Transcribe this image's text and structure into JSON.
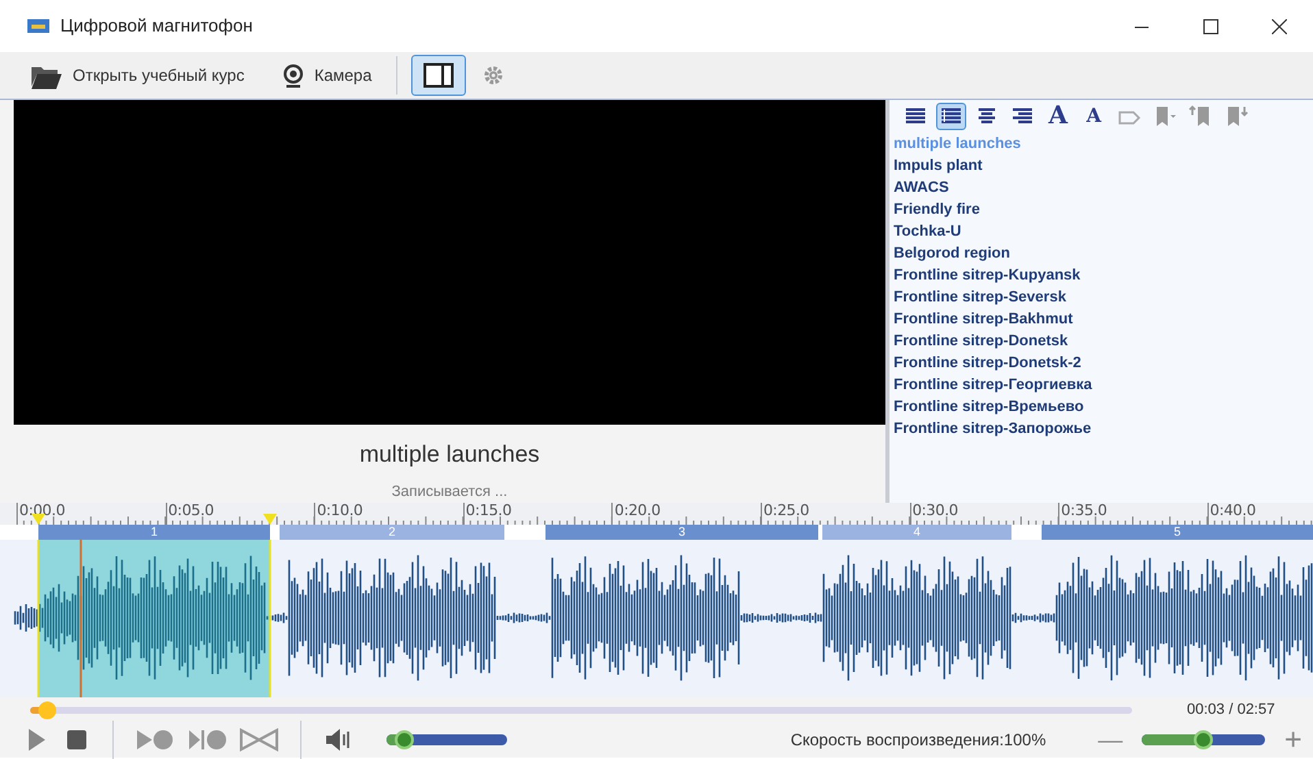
{
  "window": {
    "title": "Цифровой магнитофон"
  },
  "toolbar": [
    {
      "kind": "open",
      "label": "Открыть учебный курс"
    },
    {
      "kind": "camera",
      "label": "Камера"
    },
    {
      "kind": "layout",
      "selected": true
    },
    {
      "kind": "settings",
      "selected": false
    }
  ],
  "format_toolbar": [
    {
      "kind": "align-left",
      "selected": false
    },
    {
      "kind": "justify",
      "selected": true
    },
    {
      "kind": "align-center",
      "selected": false
    },
    {
      "kind": "align-right",
      "selected": false
    },
    {
      "kind": "font-grow",
      "label": "A"
    },
    {
      "kind": "font-shrink",
      "label": "A"
    },
    {
      "kind": "tag"
    },
    {
      "kind": "bookmark-menu"
    },
    {
      "kind": "bookmark-up"
    },
    {
      "kind": "bookmark-down"
    }
  ],
  "video": {
    "caption": "multiple launches",
    "status": "Записывается ..."
  },
  "phrases": [
    {
      "text": "multiple launches",
      "selected": true
    },
    {
      "text": "Impuls plant",
      "selected": false
    },
    {
      "text": "AWACS",
      "selected": false
    },
    {
      "text": "Friendly fire",
      "selected": false
    },
    {
      "text": "Tochka-U",
      "selected": false
    },
    {
      "text": "Belgorod region",
      "selected": false
    },
    {
      "text": "Frontline sitrep-Kupyansk",
      "selected": false
    },
    {
      "text": "Frontline sitrep-Seversk",
      "selected": false
    },
    {
      "text": "Frontline sitrep-Bakhmut",
      "selected": false
    },
    {
      "text": "Frontline sitrep-Donetsk",
      "selected": false
    },
    {
      "text": "Frontline sitrep-Donetsk-2",
      "selected": false
    },
    {
      "text": "Frontline sitrep-Георгиевка",
      "selected": false
    },
    {
      "text": "Frontline sitrep-Времьево",
      "selected": false
    },
    {
      "text": "Frontline sitrep-Запорожье",
      "selected": false
    }
  ],
  "ruler": [
    "0:00.0",
    "0:05.0",
    "0:10.0",
    "0:15.0",
    "0:20.0",
    "0:25.0",
    "0:30.0",
    "0:35.0",
    "0:40.0"
  ],
  "segments": [
    {
      "label": "1",
      "color": "#6a8fcf",
      "selected": true
    },
    {
      "label": "2",
      "color": "#9ab3e0",
      "selected": false
    },
    {
      "label": "3",
      "color": "#6a8fcf",
      "selected": false
    },
    {
      "label": "4",
      "color": "#9ab3e0",
      "selected": false
    },
    {
      "label": "5",
      "color": "#6a8fcf",
      "selected": false
    }
  ],
  "progress": {
    "level": 0.015,
    "time": "00:03 / 02:57"
  },
  "controls": [
    {
      "kind": "play"
    },
    {
      "kind": "stop"
    },
    {
      "kind": "record-after"
    },
    {
      "kind": "record-between"
    },
    {
      "kind": "join"
    }
  ],
  "volume": {
    "level": 0.15
  },
  "speed": {
    "label": "Скорость воспроизведения:100%",
    "minus": "—",
    "plus": "+",
    "level": 0.5
  }
}
